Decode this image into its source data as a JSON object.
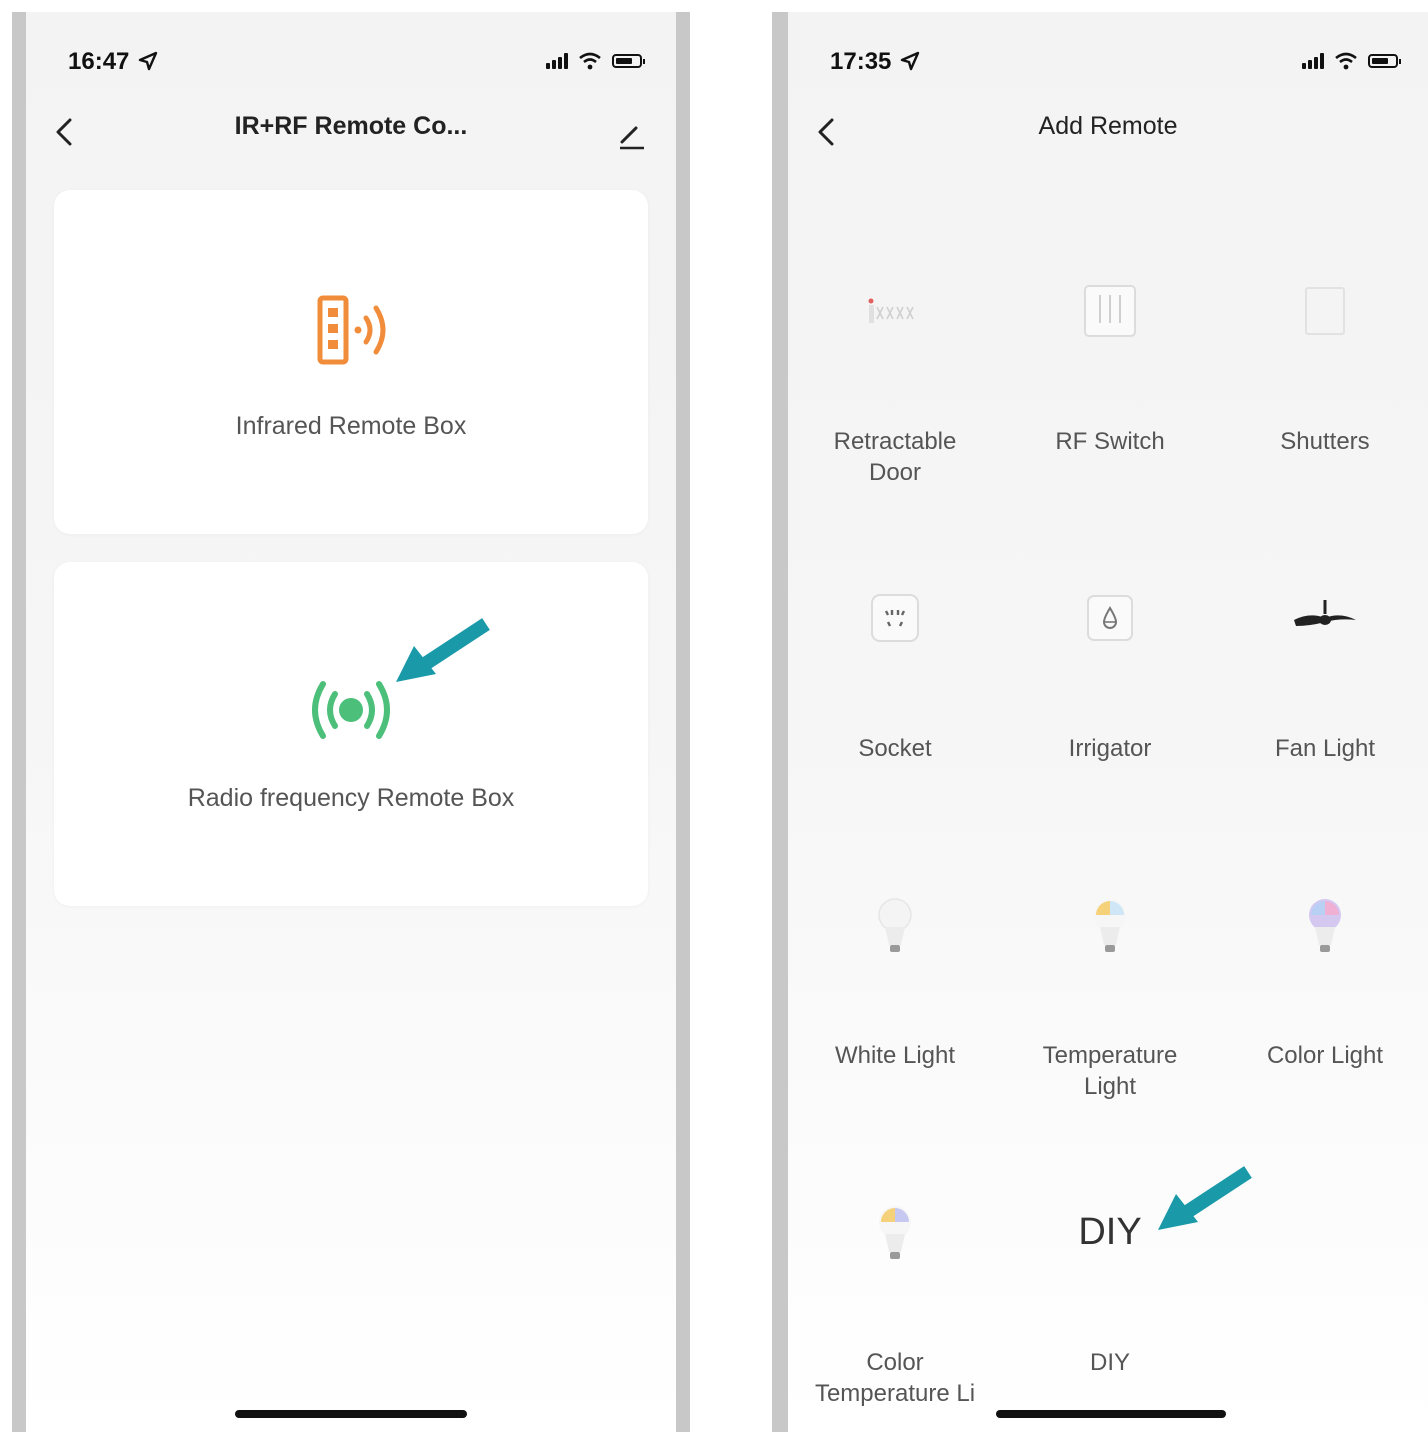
{
  "colors": {
    "accent_arrow": "#1a9aa8",
    "ir_icon": "#f08c3a",
    "rf_icon": "#4cbf7a"
  },
  "left_screen": {
    "status_time": "16:47",
    "title": "IR+RF Remote Co...",
    "cards": [
      {
        "label": "Infrared Remote Box",
        "icon": "ir-remote-icon"
      },
      {
        "label": "Radio frequency Remote Box",
        "icon": "rf-signal-icon"
      }
    ]
  },
  "right_screen": {
    "status_time": "17:35",
    "title": "Add Remote",
    "items": [
      {
        "label": "Retractable Door",
        "icon": "retractable-door-icon"
      },
      {
        "label": "RF Switch",
        "icon": "rf-switch-icon"
      },
      {
        "label": "Shutters",
        "icon": "shutters-icon"
      },
      {
        "label": "Socket",
        "icon": "socket-icon"
      },
      {
        "label": "Irrigator",
        "icon": "irrigator-icon"
      },
      {
        "label": "Fan Light",
        "icon": "fan-light-icon"
      },
      {
        "label": "White Light",
        "icon": "white-bulb-icon"
      },
      {
        "label": "Temperature Light",
        "icon": "temperature-bulb-icon"
      },
      {
        "label": "Color Light",
        "icon": "color-bulb-icon"
      },
      {
        "label": "Color Temperature Li",
        "icon": "color-temperature-bulb-icon"
      },
      {
        "label": "DIY",
        "icon": "diy-icon",
        "icon_text": "DIY"
      }
    ]
  }
}
